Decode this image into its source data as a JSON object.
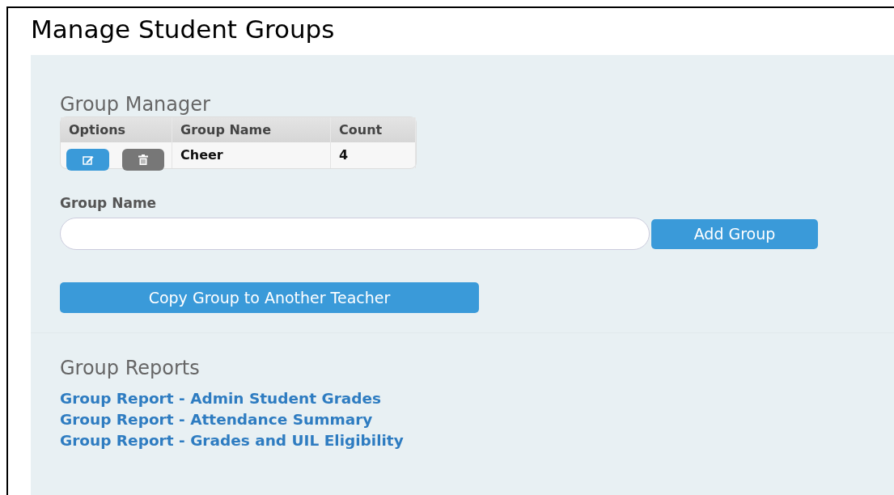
{
  "page": {
    "title": "Manage Student Groups"
  },
  "group_manager": {
    "heading": "Group Manager",
    "table": {
      "columns": [
        "Options",
        "Group Name",
        "Count"
      ],
      "rows": [
        {
          "group_name": "Cheer",
          "count": "4"
        }
      ]
    }
  },
  "form": {
    "label": "Group Name",
    "add_button": "Add Group",
    "copy_button": "Copy Group to Another Teacher"
  },
  "group_reports": {
    "heading": "Group Reports",
    "links": [
      "Group Report - Admin Student Grades",
      "Group Report - Attendance Summary",
      "Group Report - Grades and UIL Eligibility"
    ]
  }
}
